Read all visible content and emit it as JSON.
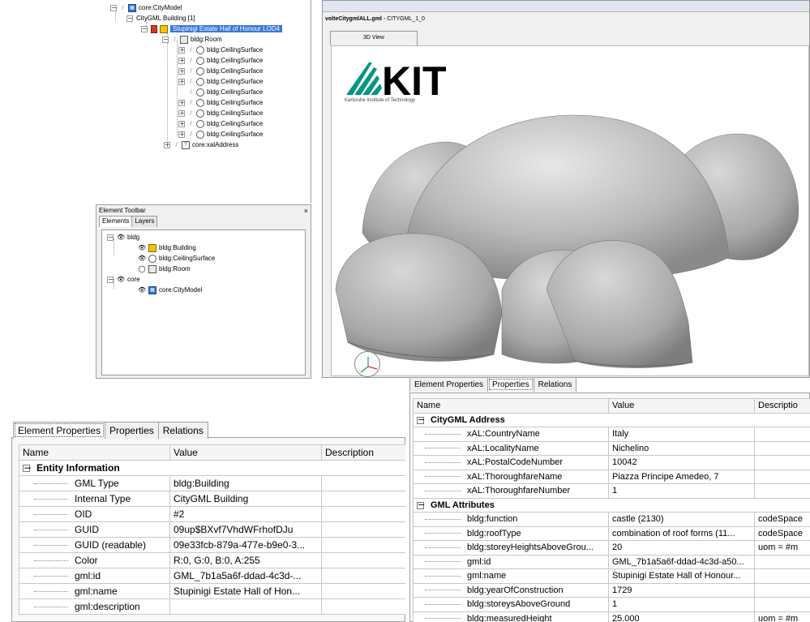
{
  "tree": {
    "nodes": [
      {
        "label": "core:CityModel",
        "icon": "citymodel-icon"
      },
      {
        "label": "CityGML Building [1]",
        "icon": ""
      },
      {
        "label": "Stupinigi Estate Hall of Honour LOD4",
        "icon": "building-icon"
      },
      {
        "label": "bldg:Room",
        "icon": "room-icon"
      },
      {
        "label": "bldg:CeilingSurface"
      },
      {
        "label": "bldg:CeilingSurface"
      },
      {
        "label": "bldg:CeilingSurface"
      },
      {
        "label": "bldg:CeilingSurface"
      },
      {
        "label": "bldg:CeilingSurface"
      },
      {
        "label": "bldg:CeilingSurface"
      },
      {
        "label": "bldg:CeilingSurface"
      },
      {
        "label": "bldg:CeilingSurface"
      },
      {
        "label": "bldg:CeilingSurface"
      },
      {
        "label": "core:xalAddress",
        "icon": "address-icon"
      }
    ]
  },
  "element_toolbar": {
    "title": "Element Toolbar",
    "close": "×",
    "tabs": [
      "Elements",
      "Layers"
    ],
    "layers": [
      {
        "label": "bldg"
      },
      {
        "label": "bldg:Building"
      },
      {
        "label": "bldg:CeilingSurface"
      },
      {
        "label": "bldg:Room"
      },
      {
        "label": "core"
      },
      {
        "label": "core:CityModel"
      }
    ]
  },
  "view": {
    "doc_name": "volteCitygmlALL.gml",
    "doc_suffix": " - CITYGML_1_0",
    "tab_label": "3D View",
    "logo_text": "KIT",
    "logo_caption": "Karlsruhe Institute of Technology"
  },
  "left_props": {
    "tabs": [
      "Element Properties",
      "Properties",
      "Relations"
    ],
    "columns": [
      "Name",
      "Value",
      "Description"
    ],
    "group": "Entity Information",
    "rows": [
      {
        "name": "GML Type",
        "value": "bldg:Building",
        "desc": ""
      },
      {
        "name": "Internal Type",
        "value": "CityGML Building",
        "desc": ""
      },
      {
        "name": "OID",
        "value": "#2",
        "desc": ""
      },
      {
        "name": "GUID",
        "value": "09up$BXvf7VhdWFrhofDJu",
        "desc": ""
      },
      {
        "name": "GUID (readable)",
        "value": "09e33fcb-879a-477e-b9e0-3...",
        "desc": ""
      },
      {
        "name": "Color",
        "value": "R:0, G:0, B:0, A:255",
        "desc": ""
      },
      {
        "name": "gml:id",
        "value": "GML_7b1a5a6f-ddad-4c3d-...",
        "desc": ""
      },
      {
        "name": "gml:name",
        "value": "Stupinigi Estate Hall of Hon...",
        "desc": ""
      },
      {
        "name": "gml:description",
        "value": "",
        "desc": ""
      }
    ]
  },
  "right_props": {
    "tabs": [
      "Element Properties",
      "Properties",
      "Relations"
    ],
    "columns": [
      "Name",
      "Value",
      "Descriptio"
    ],
    "group1": "CityGML Address",
    "rows1": [
      {
        "name": "xAL:CountryName",
        "value": "Italy",
        "desc": ""
      },
      {
        "name": "xAL:LocalityName",
        "value": "Nichelino",
        "desc": ""
      },
      {
        "name": "xAL:PostalCodeNumber",
        "value": "10042",
        "desc": ""
      },
      {
        "name": "xAL:ThoroughfareName",
        "value": "Piazza Principe Amedeo, 7",
        "desc": ""
      },
      {
        "name": "xAL:ThoroughfareNumber",
        "value": "1",
        "desc": ""
      }
    ],
    "group2": "GML Attributes",
    "rows2": [
      {
        "name": "bldg:function",
        "value": "castle (2130)",
        "desc": "codeSpace"
      },
      {
        "name": "bldg:roofType",
        "value": "combination of roof forms (11...",
        "desc": "codeSpace"
      },
      {
        "name": "bldg:storeyHeightsAboveGrou...",
        "value": "20",
        "desc": "uom = #m"
      },
      {
        "name": "gml:id",
        "value": "GML_7b1a5a6f-ddad-4c3d-a50...",
        "desc": ""
      },
      {
        "name": "gml:name",
        "value": "Stupinigi Estate Hall of Honour...",
        "desc": ""
      },
      {
        "name": "bldg:yearOfConstruction",
        "value": "1729",
        "desc": ""
      },
      {
        "name": "bldg:storeysAboveGround",
        "value": "1",
        "desc": ""
      },
      {
        "name": "bldg:measuredHeight",
        "value": "25.000",
        "desc": "uom = #m"
      }
    ]
  },
  "colors": {
    "selection": "#3a78d8",
    "kit_green": "#009682"
  }
}
